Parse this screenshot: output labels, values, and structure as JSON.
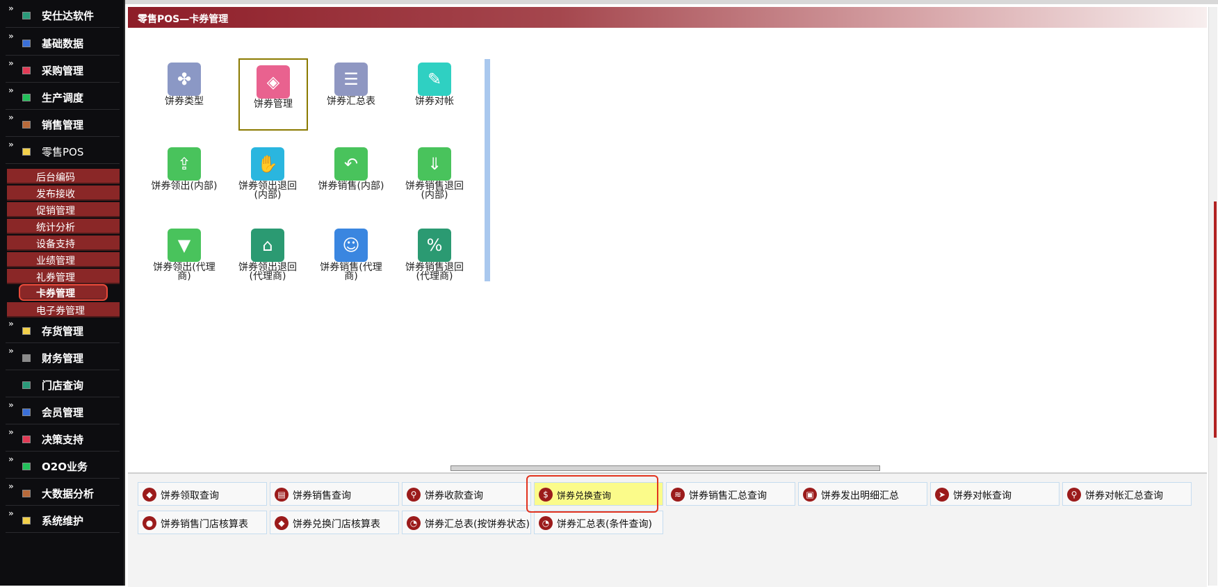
{
  "header": {
    "title": "零售POS—卡券管理"
  },
  "sidebar": {
    "items": [
      {
        "label": "安仕达软件",
        "arrow": "»",
        "icon_color": "#2a9a7a"
      },
      {
        "label": "基础数据",
        "arrow": "»",
        "icon_color": "#3a6fd8"
      },
      {
        "label": "采购管理",
        "arrow": "»",
        "icon_color": "#e23a55"
      },
      {
        "label": "生产调度",
        "arrow": "»",
        "icon_color": "#22c05a"
      },
      {
        "label": "销售管理",
        "arrow": "»",
        "icon_color": "#b86a3a"
      },
      {
        "label": "零售POS",
        "arrow": "»",
        "icon_color": "#f2d04a"
      }
    ],
    "pos_sub": [
      {
        "label": "后台编码"
      },
      {
        "label": "发布接收"
      },
      {
        "label": "促销管理"
      },
      {
        "label": "统计分析"
      },
      {
        "label": "设备支持"
      },
      {
        "label": "业绩管理"
      },
      {
        "label": "礼券管理"
      },
      {
        "label": "卡券管理"
      },
      {
        "label": "电子券管理"
      }
    ],
    "items_after": [
      {
        "label": "存货管理",
        "arrow": "»",
        "icon_color": "#f2d04a"
      },
      {
        "label": "财务管理",
        "arrow": "»",
        "icon_color": "#8a8a8a"
      },
      {
        "label": "门店查询",
        "arrow": "",
        "icon_color": "#2a9a7a"
      },
      {
        "label": "会员管理",
        "arrow": "»",
        "icon_color": "#3a6fd8"
      },
      {
        "label": "决策支持",
        "arrow": "»",
        "icon_color": "#e23a55"
      },
      {
        "label": "O2O业务",
        "arrow": "»",
        "icon_color": "#22c05a"
      },
      {
        "label": "大数据分析",
        "arrow": "»",
        "icon_color": "#b86a3a"
      },
      {
        "label": "系统维护",
        "arrow": "»",
        "icon_color": "#f2d04a"
      }
    ]
  },
  "tiles": [
    {
      "label": "饼券类型",
      "icon": "grid-icon",
      "glyph": "✤",
      "color": "#8b98c5"
    },
    {
      "label": "饼券管理",
      "icon": "tag-icon",
      "glyph": "◈",
      "color": "#e9628f"
    },
    {
      "label": "饼券汇总表",
      "icon": "server-icon",
      "glyph": "☰",
      "color": "#8f97c2"
    },
    {
      "label": "饼券对帐",
      "icon": "pin-document-icon",
      "glyph": "✎",
      "color": "#2fd0c2"
    },
    {
      "label": "饼券领出(内部)",
      "icon": "folder-upload-icon",
      "glyph": "⇪",
      "color": "#49c35c"
    },
    {
      "label": "饼券领出退回(内部)",
      "icon": "receipt-icon",
      "glyph": "✋",
      "color": "#2ab6df"
    },
    {
      "label": "饼券销售(内部)",
      "icon": "return-arrow-icon",
      "glyph": "↶",
      "color": "#49c35c"
    },
    {
      "label": "饼券销售退回(内部)",
      "icon": "folder-download-icon",
      "glyph": "⇓",
      "color": "#49c35c"
    },
    {
      "label": "饼券领出(代理商)",
      "icon": "folder-open-icon",
      "glyph": "▼",
      "color": "#49c35c"
    },
    {
      "label": "饼券领出退回(代理商)",
      "icon": "house-chart-icon",
      "glyph": "⌂",
      "color": "#2b9a72"
    },
    {
      "label": "饼券销售(代理商)",
      "icon": "users-icon",
      "glyph": "☺",
      "color": "#3a86e0"
    },
    {
      "label": "饼券销售退回(代理商)",
      "icon": "discount-gear-icon",
      "glyph": "%",
      "color": "#2b9a72"
    }
  ],
  "queries": [
    {
      "label": "饼券领取查询",
      "icon": "tag-icon",
      "glyph": "◆"
    },
    {
      "label": "饼券销售查询",
      "icon": "clipboard-icon",
      "glyph": "▤"
    },
    {
      "label": "饼券收款查询",
      "icon": "search-icon",
      "glyph": "⚲"
    },
    {
      "label": "饼券兑换查询",
      "icon": "dollar-icon",
      "glyph": "$"
    },
    {
      "label": "饼券销售汇总查询",
      "icon": "layers-icon",
      "glyph": "≋"
    },
    {
      "label": "饼券发出明细汇总",
      "icon": "contact-card-icon",
      "glyph": "▣"
    },
    {
      "label": "饼券对帐查询",
      "icon": "send-icon",
      "glyph": "➤"
    },
    {
      "label": "饼券对帐汇总查询",
      "icon": "search-icon",
      "glyph": "⚲"
    },
    {
      "label": "饼券销售门店核算表",
      "icon": "user-icon",
      "glyph": "●"
    },
    {
      "label": "饼券兑换门店核算表",
      "icon": "tag-icon",
      "glyph": "◆"
    },
    {
      "label": "饼券汇总表(按饼券状态)",
      "icon": "pie-chart-icon",
      "glyph": "◔"
    },
    {
      "label": "饼券汇总表(条件查询)",
      "icon": "pie-chart-icon",
      "glyph": "◔"
    }
  ]
}
